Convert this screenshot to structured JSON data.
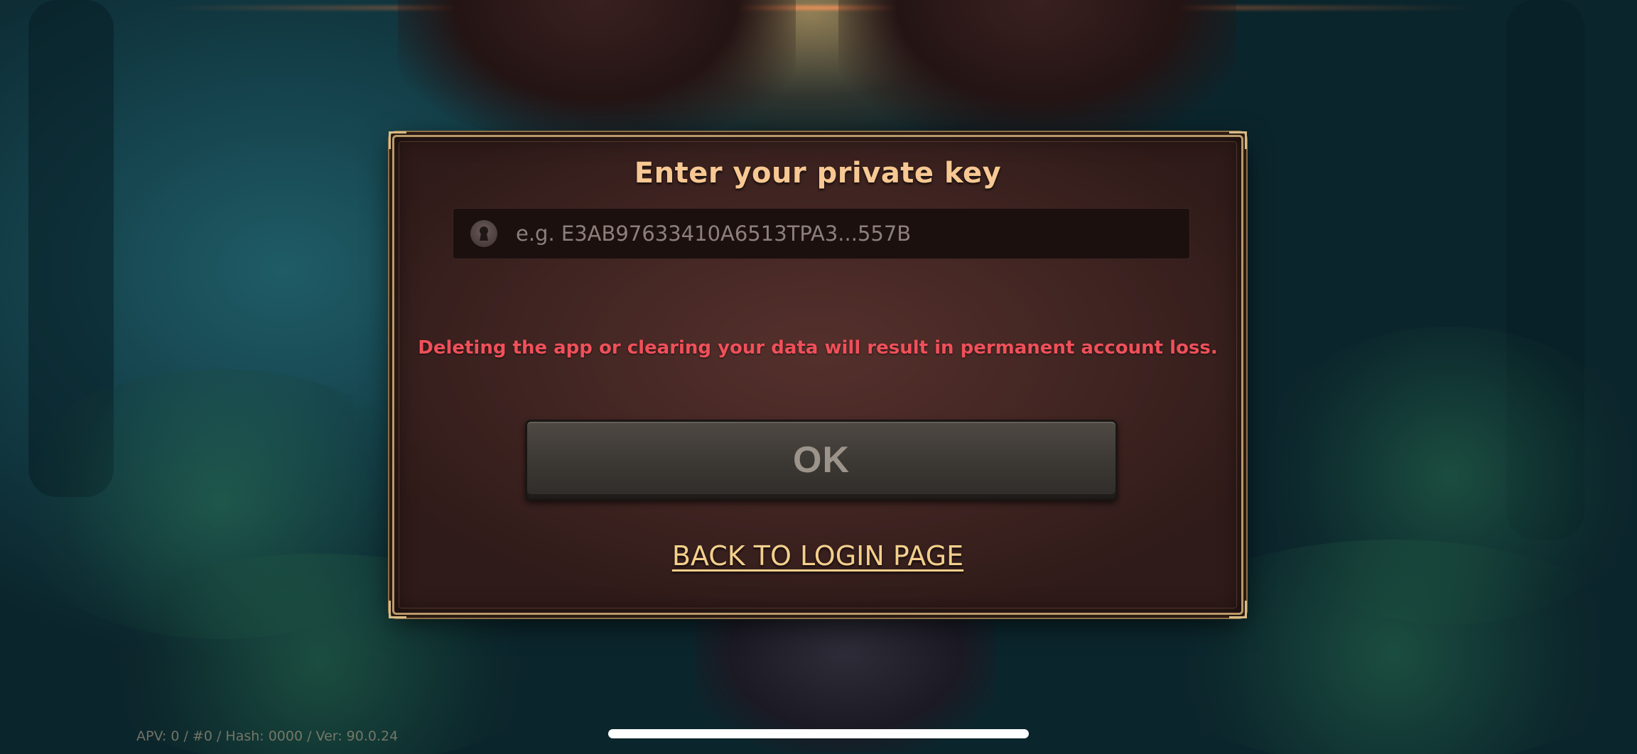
{
  "dialog": {
    "title": "Enter your private key",
    "key_input": {
      "placeholder": "e.g. E3AB97633410A6513TPA3...557B",
      "value": ""
    },
    "warning": "Deleting the app or clearing your data will result in permanent account loss.",
    "ok_label": "OK",
    "back_link": "BACK TO LOGIN PAGE"
  },
  "footer": {
    "version_info": "APV: 0 / #0 / Hash: 0000 / Ver: 90.0.24"
  },
  "colors": {
    "title": "#f7c893",
    "warning": "#f0505a",
    "link": "#f4cf8c",
    "dialog_border": "#b9996a",
    "button": "#3b3733"
  },
  "icons": {
    "key_field_icon": "keyhole-icon"
  }
}
